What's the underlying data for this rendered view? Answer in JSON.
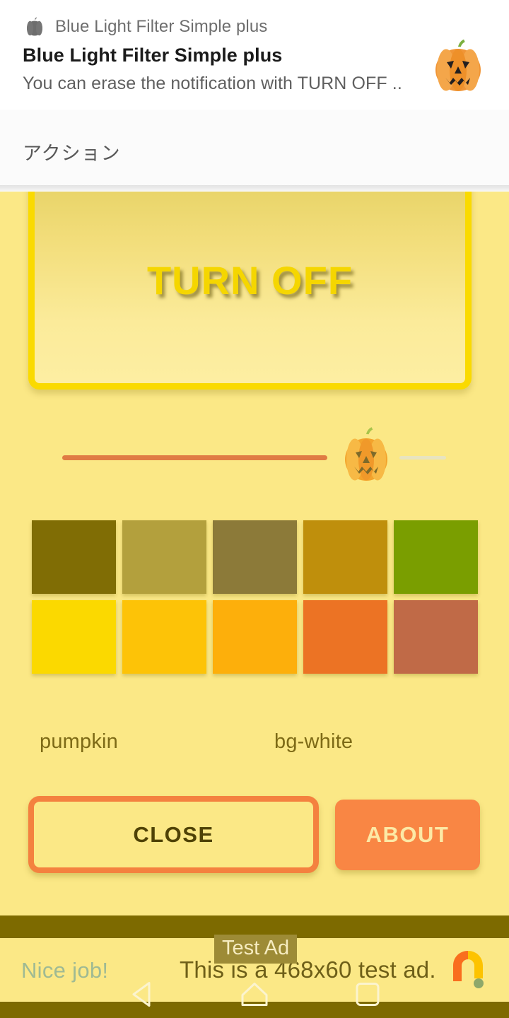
{
  "notification": {
    "app_icon": "pumpkin-icon-gray",
    "app_name": "Blue Light Filter Simple plus",
    "title": "Blue Light Filter Simple plus",
    "body": "You can erase the notification with TURN OFF ..",
    "large_icon": "pumpkin-icon"
  },
  "action_section": {
    "label": "アクション"
  },
  "app": {
    "background_color": "#fbe886",
    "turn_off_button": {
      "label": "TURN OFF",
      "border_color": "#fada00",
      "text_color": "#f5d600"
    },
    "opacity_slider": {
      "thumb_icon": "pumpkin-slider-thumb",
      "active_track_color": "#e07b43",
      "inactive_track_color": "#e8e4c0",
      "value_percent": 85
    },
    "palette": {
      "swatches": [
        {
          "name": "swatch-1",
          "color": "#806d05"
        },
        {
          "name": "swatch-2",
          "color": "#b3a03d"
        },
        {
          "name": "swatch-3",
          "color": "#8c7a39"
        },
        {
          "name": "swatch-4",
          "color": "#bf8f0c"
        },
        {
          "name": "swatch-5",
          "color": "#7a9e00"
        },
        {
          "name": "swatch-6",
          "color": "#fbd900"
        },
        {
          "name": "swatch-7",
          "color": "#fdc307"
        },
        {
          "name": "swatch-8",
          "color": "#fdaf0b"
        },
        {
          "name": "swatch-9",
          "color": "#ec7324"
        },
        {
          "name": "swatch-10",
          "color": "#c06a47"
        }
      ],
      "labels": {
        "left": "pumpkin",
        "right": "bg-white"
      }
    },
    "buttons": {
      "close": {
        "label": "CLOSE",
        "border_color": "#f4813f",
        "text_color": "#4f4206"
      },
      "about": {
        "label": "ABOUT",
        "fill_color": "#f98644",
        "text_color": "#fce9a6"
      }
    }
  },
  "ad": {
    "badge": "Test Ad",
    "left_text": "Nice job!",
    "main_text": "This is a 468x60 test ad.",
    "logo": "admob-logo",
    "frame_color": "#7d6a00"
  },
  "navbar": {
    "back": "back-icon",
    "home": "home-icon",
    "recents": "recents-icon"
  }
}
